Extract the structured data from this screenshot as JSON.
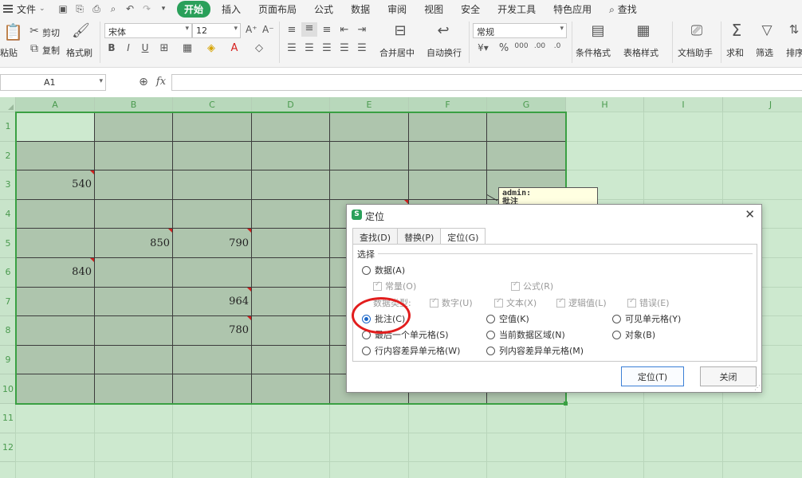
{
  "menu": {
    "file": "文件",
    "start_tab": "开始",
    "items": [
      "插入",
      "页面布局",
      "公式",
      "数据",
      "审阅",
      "视图",
      "安全",
      "开发工具",
      "特色应用"
    ],
    "search": "查找"
  },
  "ribbon": {
    "paste": "粘贴",
    "cut": "剪切",
    "copy": "复制",
    "format_painter": "格式刷",
    "font_name": "宋体",
    "font_size": "12",
    "merge_center": "合并居中",
    "wrap_text": "自动换行",
    "number_format": "常规",
    "cond_format": "条件格式",
    "table_style": "表格样式",
    "doc_assistant": "文档助手",
    "sum": "求和",
    "filter": "筛选",
    "sort": "排序"
  },
  "formula_bar": {
    "name_box": "A1",
    "fx": "fx"
  },
  "sheet": {
    "columns": [
      "A",
      "B",
      "C",
      "D",
      "E",
      "F",
      "G",
      "H",
      "I",
      "J"
    ],
    "rows": [
      "1",
      "2",
      "3",
      "4",
      "5",
      "6",
      "7",
      "8",
      "9",
      "10",
      "11",
      "12"
    ],
    "values": [
      {
        "col": 0,
        "row": 2,
        "value": "540"
      },
      {
        "col": 1,
        "row": 4,
        "value": "850"
      },
      {
        "col": 2,
        "row": 4,
        "value": "790"
      },
      {
        "col": 0,
        "row": 5,
        "value": "840"
      },
      {
        "col": 2,
        "row": 6,
        "value": "964"
      },
      {
        "col": 2,
        "row": 7,
        "value": "780"
      }
    ],
    "comment_markers": [
      {
        "col": 0,
        "row": 2
      },
      {
        "col": 1,
        "row": 4
      },
      {
        "col": 2,
        "row": 4
      },
      {
        "col": 0,
        "row": 5
      },
      {
        "col": 2,
        "row": 6
      },
      {
        "col": 2,
        "row": 7
      },
      {
        "col": 4,
        "row": 3
      },
      {
        "col": 6,
        "row": 3
      }
    ],
    "comment_text": "admin:\n批注"
  },
  "dialog": {
    "title": "定位",
    "tabs": [
      "查找(D)",
      "替换(P)",
      "定位(G)"
    ],
    "group_label": "选择",
    "options": {
      "data": "数据(A)",
      "constants": "常量(O)",
      "formulas": "公式(R)",
      "data_type": "数据类型:",
      "number": "数字(U)",
      "text": "文本(X)",
      "logical": "逻辑值(L)",
      "error": "错误(E)",
      "comments": "批注(C)",
      "blanks": "空值(K)",
      "visible_cells": "可见单元格(Y)",
      "last_cell": "最后一个单元格(S)",
      "current_region": "当前数据区域(N)",
      "objects": "对象(B)",
      "row_diff": "行内容差异单元格(W)",
      "col_diff": "列内容差异单元格(M)"
    },
    "ok": "定位(T)",
    "close": "关闭"
  },
  "colors": {
    "accent": "#2aa05a",
    "sheet_bg": "#cde9cf",
    "selection_fill": "#aec5ad",
    "highlight_circle": "#e21d1d"
  }
}
